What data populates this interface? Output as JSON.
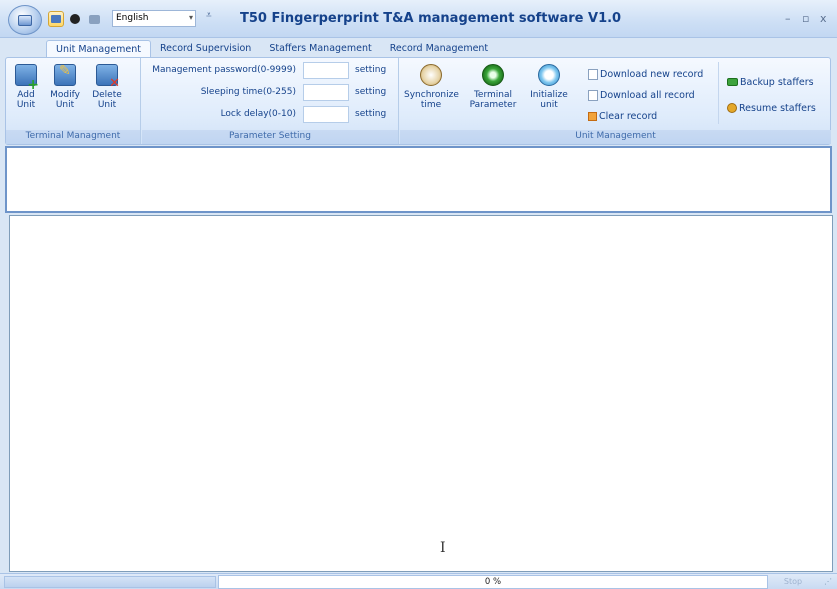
{
  "titlebar": {
    "title": "T50 Fingerperprint T&A management software V1.0",
    "language": "English",
    "qat_more": "₹",
    "minimize": "–",
    "maximize": "▫",
    "close": "x"
  },
  "tabs": [
    {
      "label": "Unit Management",
      "active": true
    },
    {
      "label": "Record Supervision"
    },
    {
      "label": "Staffers Management"
    },
    {
      "label": "Record Management"
    }
  ],
  "groups": {
    "terminal": {
      "label": "Terminal Managment",
      "buttons": [
        {
          "line1": "Add",
          "line2": "Unit",
          "icon": "add-unit-icon"
        },
        {
          "line1": "Modify",
          "line2": "Unit",
          "icon": "modify-unit-icon"
        },
        {
          "line1": "Delete",
          "line2": "Unit",
          "icon": "delete-unit-icon"
        }
      ]
    },
    "parameter": {
      "label": "Parameter Setting",
      "rows": [
        {
          "label": "Management password(0-9999)",
          "value": "",
          "button": "setting"
        },
        {
          "label": "Sleeping time(0-255)",
          "value": "",
          "button": "setting"
        },
        {
          "label": "Lock delay(0-10)",
          "value": "",
          "button": "setting"
        }
      ]
    },
    "unit": {
      "label": "Unit Management",
      "buttons": [
        {
          "line1": "Synchronize",
          "line2": "time",
          "icon": "clock-icon"
        },
        {
          "line1": "Terminal",
          "line2": "Parameter",
          "icon": "gear-icon"
        },
        {
          "line1": "Initialize",
          "line2": "unit",
          "icon": "initialize-icon"
        }
      ],
      "small": [
        {
          "label": "Download new record",
          "icon": "document-icon"
        },
        {
          "label": "Download all record",
          "icon": "document-icon"
        },
        {
          "label": "Clear record",
          "icon": "clear-icon"
        }
      ],
      "staff": [
        {
          "label": "Backup staffers",
          "icon": "backup-icon"
        },
        {
          "label": "Resume staffers",
          "icon": "resume-icon"
        }
      ]
    }
  },
  "statusbar": {
    "progress_text": "0 %",
    "progress_value": 0,
    "stop_label": "Stop"
  },
  "colors": {
    "accent": "#15428b",
    "border": "#a9c3e6"
  }
}
